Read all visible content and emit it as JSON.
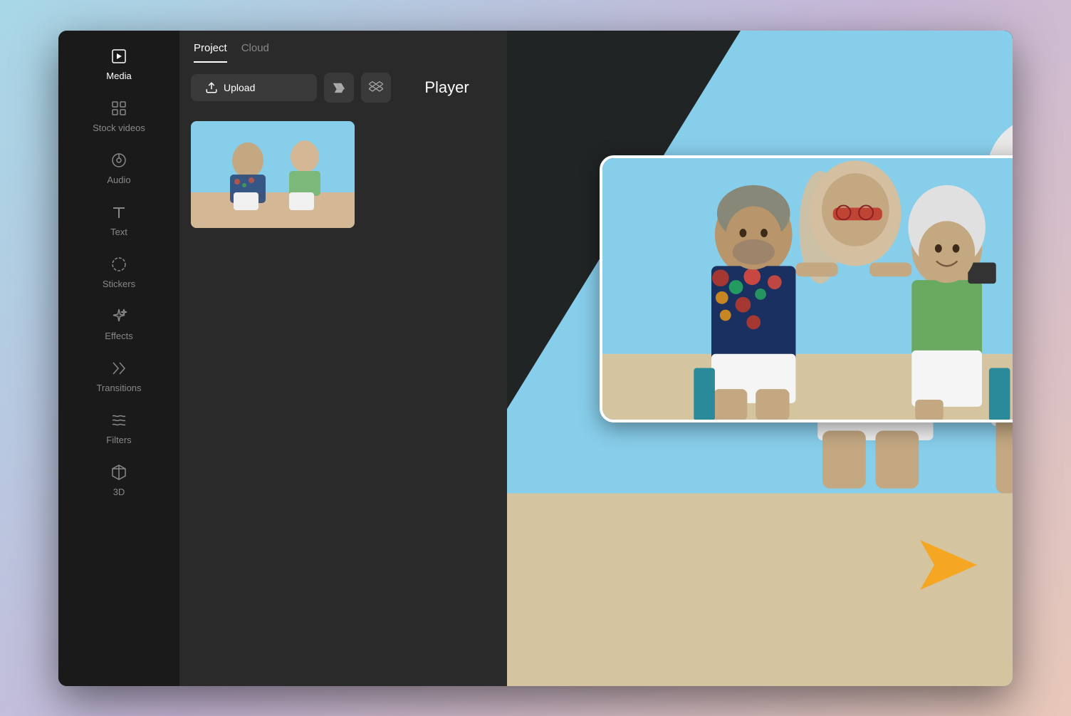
{
  "window": {
    "background": "gradient"
  },
  "sidebar": {
    "items": [
      {
        "id": "media",
        "label": "Media",
        "icon": "play-square",
        "active": true
      },
      {
        "id": "stock-videos",
        "label": "Stock videos",
        "icon": "grid"
      },
      {
        "id": "audio",
        "label": "Audio",
        "icon": "music-circle"
      },
      {
        "id": "text",
        "label": "Text",
        "icon": "letter-t"
      },
      {
        "id": "stickers",
        "label": "Stickers",
        "icon": "circle-dashed"
      },
      {
        "id": "effects",
        "label": "Effects",
        "icon": "sparkle-star"
      },
      {
        "id": "transitions",
        "label": "Transitions",
        "icon": "arrows-cross"
      },
      {
        "id": "filters",
        "label": "Filters",
        "icon": "cloud-filter"
      },
      {
        "id": "3d",
        "label": "3D",
        "icon": "cube"
      }
    ]
  },
  "media_panel": {
    "tabs": [
      {
        "label": "Project",
        "active": true
      },
      {
        "label": "Cloud",
        "active": false
      }
    ],
    "toolbar": {
      "upload_button": "Upload",
      "google_drive_tooltip": "Google Drive",
      "dropbox_tooltip": "Dropbox"
    },
    "player_label": "Player"
  }
}
